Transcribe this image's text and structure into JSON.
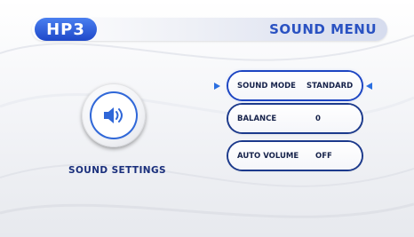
{
  "header": {
    "logo_text": "HP3",
    "title": "SOUND MENU"
  },
  "panel": {
    "icon": "speaker-icon",
    "caption": "SOUND SETTINGS"
  },
  "menu": {
    "selected_index": 0,
    "items": [
      {
        "label": "SOUND MODE",
        "value": "STANDARD"
      },
      {
        "label": "BALANCE",
        "value": "0"
      },
      {
        "label": "AUTO VOLUME",
        "value": "OFF"
      }
    ]
  },
  "colors": {
    "accent": "#2a52c2",
    "logo_bg": "#1f49c9",
    "outline": "#1c3a8c",
    "text_dark": "#16224a"
  }
}
